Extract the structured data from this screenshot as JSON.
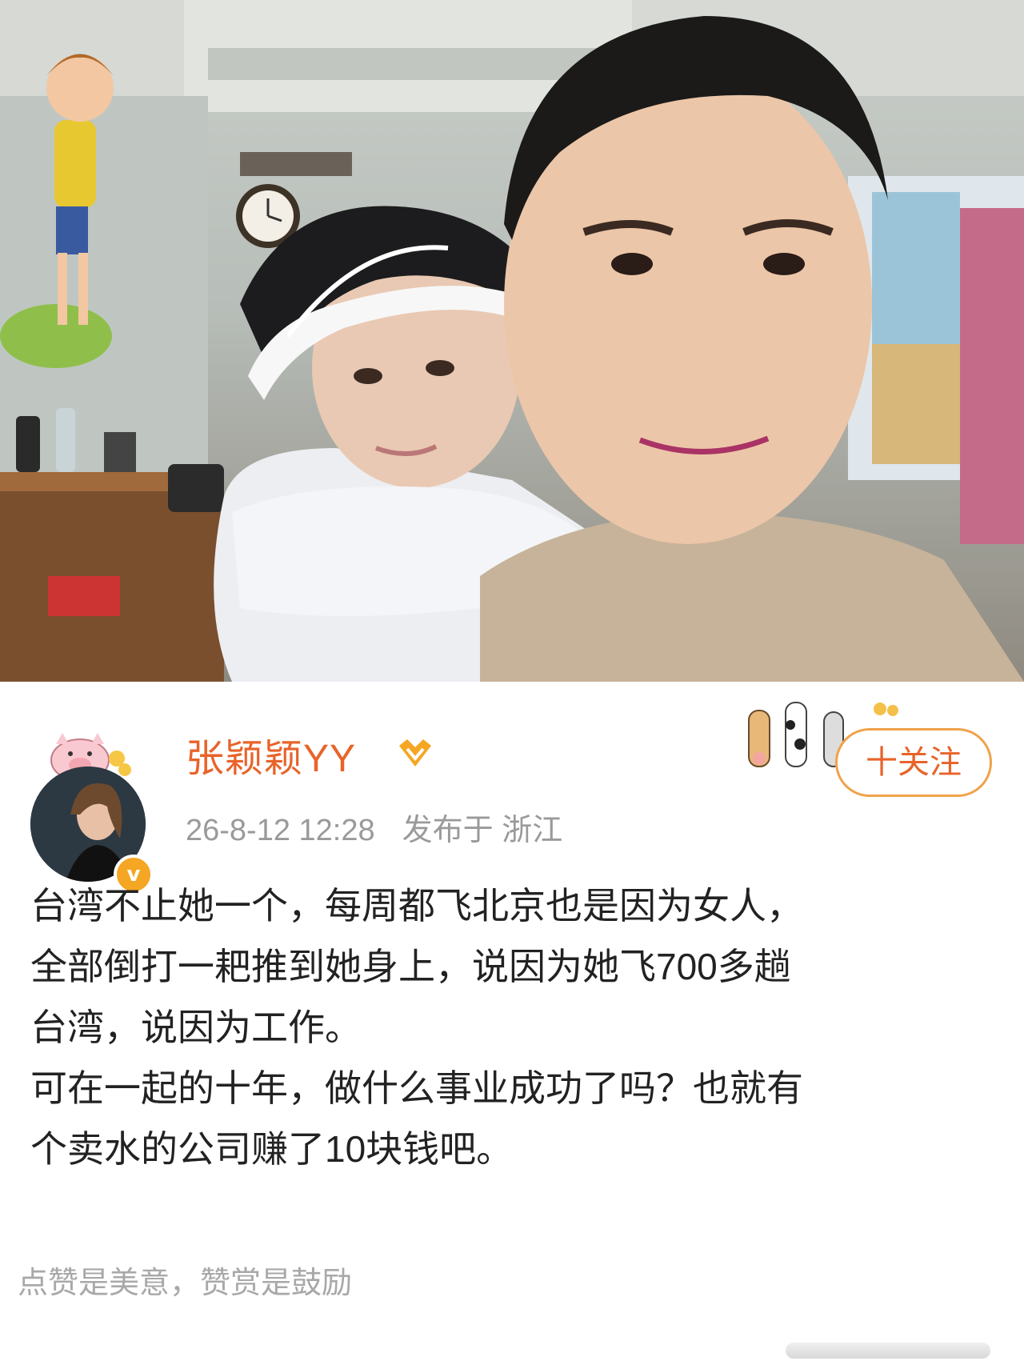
{
  "photo": {
    "alt_icon": "photo-image"
  },
  "post": {
    "username": "张颖颖YY",
    "date": "26-8-12 12:28",
    "location": "发布于 浙江",
    "follow_label": "十关注",
    "content_lines": [
      "台湾不止她一个，每周都飞北京也是因为女人，",
      "全部倒打一耙推到她身上，说因为她飞700多趟",
      "台湾，说因为工作。",
      "可在一起的十年，做什么事业成功了吗？也就有",
      "个卖水的公司赚了10块钱吧。"
    ],
    "reward_tip": "点赞是美意，赞赏是鼓励",
    "verified_mark": "v",
    "colors": {
      "username": "#e8632a",
      "follow_border": "#f0a24a",
      "badge": "#f5a623",
      "meta": "#9a9a9a"
    }
  }
}
